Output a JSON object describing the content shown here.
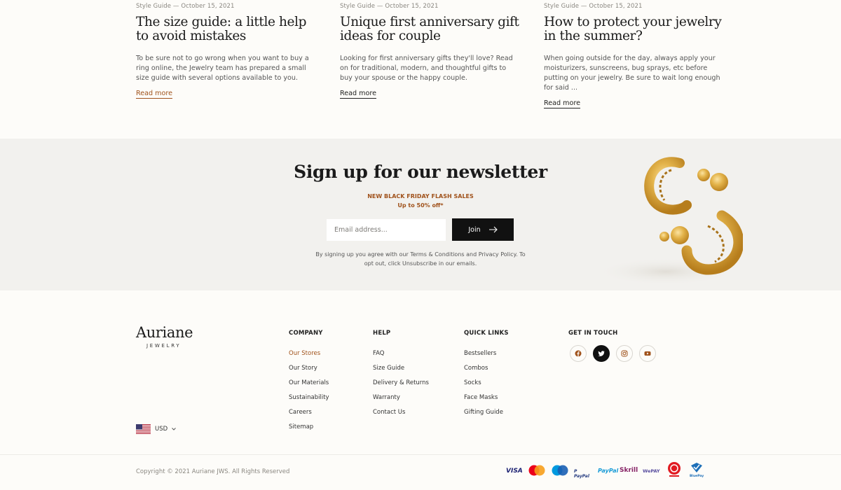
{
  "articles": [
    {
      "meta": "Style Guide — October 15, 2021",
      "title": "The size guide: a little help to avoid mistakes",
      "excerpt": "To be sure not to go wrong when you want to buy a ring online, the Jewelry team has prepared a small size guide with several options available to you.",
      "read_more": "Read more"
    },
    {
      "meta": "Style Guide — October 15, 2021",
      "title": "Unique first anniversary gift ideas for couple",
      "excerpt": "Looking for first anniversary gifts they'll love? Read on for traditional, modern, and thoughtful gifts to buy your spouse or the happy couple.",
      "read_more": "Read more"
    },
    {
      "meta": "Style Guide — October 15, 2021",
      "title": "How to protect your jewelry in the summer?",
      "excerpt": "When going outside for the day, always apply your moisturizers, sunscreens, bug sprays, etc before putting on your jewelry. Be sure to wait long enough for said ...",
      "read_more": "Read more"
    }
  ],
  "newsletter": {
    "title": "Sign up for our newsletter",
    "promo_line1": "NEW BLACK FRIDAY FLASH SALES",
    "promo_line2": "Up to 50% off*",
    "email_placeholder": "Email address...",
    "join_label": "Join",
    "legal": "By signing up you agree with our Terms & Conditions and Privacy Policy. To opt out, click Unsubscribe in our emails."
  },
  "brand": {
    "name": "Auriane",
    "sub": "JEWELRY",
    "accent_color": "#a0521b"
  },
  "footer": {
    "company": {
      "heading": "COMPANY",
      "items": [
        "Our Stores",
        "Our Story",
        "Our Materials",
        "Sustainability",
        "Careers",
        "Sitemap"
      ]
    },
    "help": {
      "heading": "HELP",
      "items": [
        "FAQ",
        "Size Guide",
        "Delivery & Returns",
        "Warranty",
        "Contact Us"
      ]
    },
    "quick_links": {
      "heading": "QUICK LINKS",
      "items": [
        "Bestsellers",
        "Combos",
        "Socks",
        "Face Masks",
        "Gifting Guide"
      ]
    },
    "get_in_touch": {
      "heading": "GET IN TOUCH",
      "social": [
        "facebook-icon",
        "twitter-icon",
        "instagram-icon",
        "youtube-icon"
      ]
    },
    "currency": "USD",
    "copyright": "Copyright © 2021 Auriane JWS. All Rights Reserved",
    "payments": {
      "visa": "VISA",
      "paypal_small": "P PayPal",
      "paypal": "PayPal",
      "skrill": "Skrill",
      "wepay": "WePAY",
      "bluepay": "BluePay"
    }
  }
}
